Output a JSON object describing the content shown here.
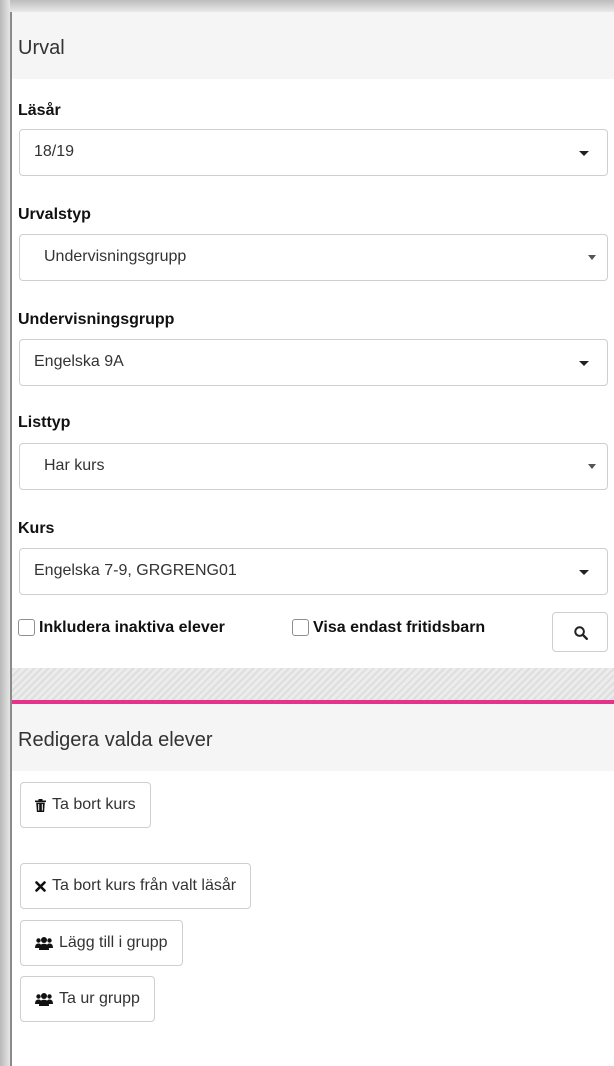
{
  "urval": {
    "heading": "Urval",
    "lasar": {
      "label": "Läsår",
      "value": "18/19"
    },
    "urvalstyp": {
      "label": "Urvalstyp",
      "value": "Undervisningsgrupp"
    },
    "undervisningsgrupp": {
      "label": "Undervisningsgrupp",
      "value": "Engelska 9A"
    },
    "listtyp": {
      "label": "Listtyp",
      "value": "Har kurs"
    },
    "kurs": {
      "label": "Kurs",
      "value": "Engelska 7-9, GRGRENG01"
    },
    "checkboxes": {
      "inactive_label": "Inkludera inaktiva elever",
      "inactive_checked": false,
      "fritid_label": "Visa endast fritidsbarn",
      "fritid_checked": false
    },
    "search_icon": "search-icon"
  },
  "redigera": {
    "heading": "Redigera valda elever",
    "buttons": [
      {
        "label": "Ta bort kurs",
        "icon": "trash-icon"
      },
      {
        "label": "Ta bort kurs från valt läsår",
        "icon": "close-icon"
      },
      {
        "label": "Lägg till i grupp",
        "icon": "users-icon"
      },
      {
        "label": "Ta ur grupp",
        "icon": "users-icon"
      }
    ]
  },
  "colors": {
    "accent_line": "#e4348a",
    "heading_bg": "#f5f5f5"
  }
}
